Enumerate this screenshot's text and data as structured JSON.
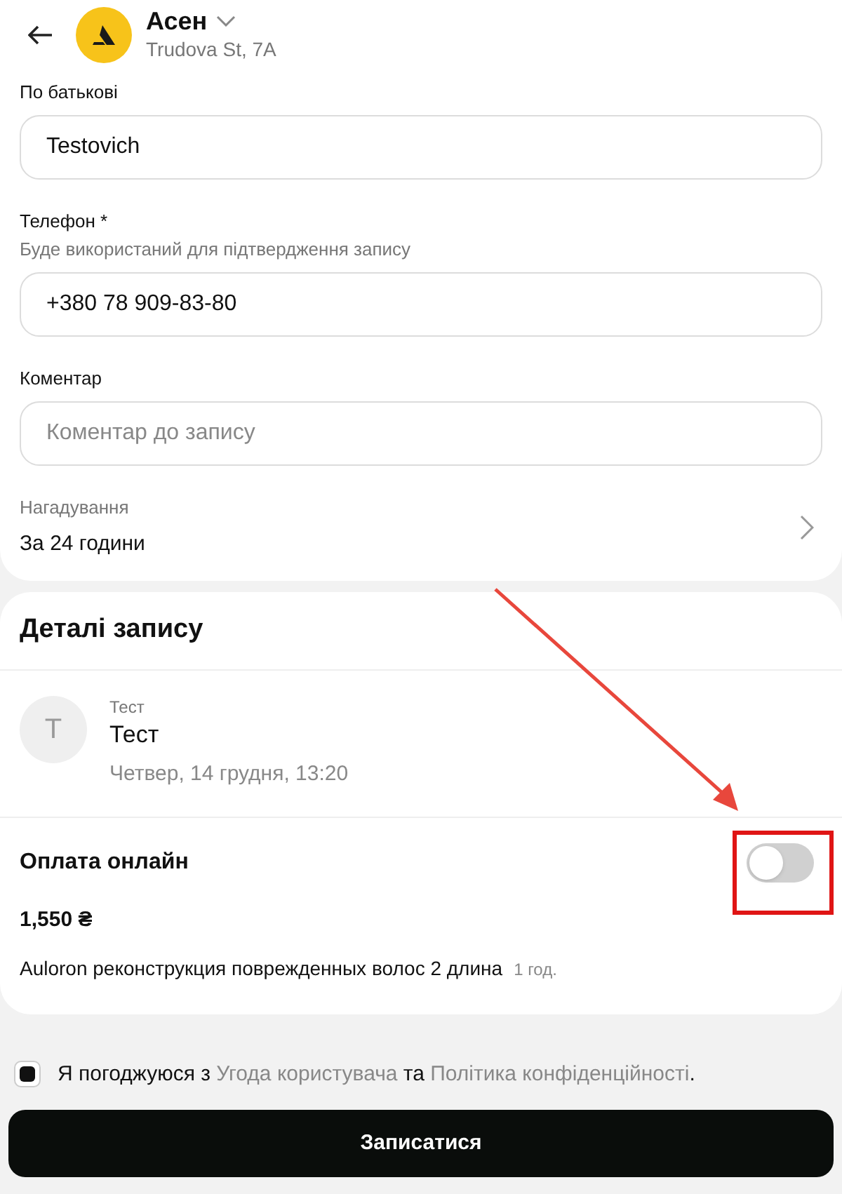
{
  "header": {
    "title": "Асен",
    "address": "Trudova St, 7A"
  },
  "fields": [
    {
      "kind": "input",
      "label": "По батькові",
      "value": "Testovich"
    },
    {
      "kind": "input",
      "label": "Телефон *",
      "hint": "Буде використаний для підтвердження запису",
      "value": "+380 78 909-83-80"
    },
    {
      "kind": "input",
      "label": "Коментар",
      "placeholder": "Коментар до запису"
    },
    {
      "kind": "select",
      "label": "Нагадування",
      "value": "За 24 години"
    }
  ],
  "details": {
    "title": "Деталі запису",
    "staff": {
      "initial": "T",
      "role": "Тест",
      "name": "Тест",
      "datetime": "Четвер, 14 грудня, 13:20"
    },
    "online_payment": {
      "label": "Оплата онлайн",
      "on": false
    },
    "price": "1,550 ₴",
    "service": "Auloron реконструкция поврежденных волос 2 длина",
    "duration": "1 год."
  },
  "agreement": {
    "checked": true,
    "parts": [
      {
        "kind": "text",
        "text": "Я погоджуюся з "
      },
      {
        "kind": "link",
        "text": "Угода користувача"
      },
      {
        "kind": "text",
        "text": " та "
      },
      {
        "kind": "link",
        "text": "Політика конфіденційності"
      },
      {
        "kind": "text",
        "text": "."
      }
    ]
  },
  "submit": "Записатися"
}
